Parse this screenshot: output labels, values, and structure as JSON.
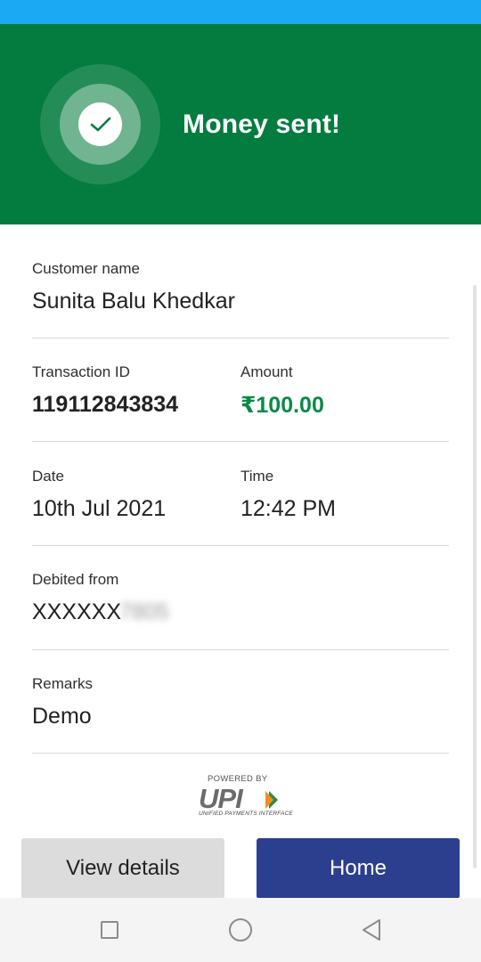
{
  "header": {
    "title": "Money sent!",
    "icon": "check-icon",
    "background_color": "#047c3f"
  },
  "details": {
    "customer_name": {
      "label": "Customer name",
      "value": "Sunita Balu Khedkar"
    },
    "transaction_id": {
      "label": "Transaction ID",
      "value": "119112843834"
    },
    "amount": {
      "label": "Amount",
      "value": "₹100.00",
      "color": "#0a8a47"
    },
    "date": {
      "label": "Date",
      "value": "10th Jul 2021"
    },
    "time": {
      "label": "Time",
      "value": "12:42 PM"
    },
    "debited_from": {
      "label": "Debited from",
      "value_visible": "XXXXXX",
      "value_blurred": "7805"
    },
    "remarks": {
      "label": "Remarks",
      "value": "Demo"
    }
  },
  "branding": {
    "powered_by": "POWERED BY",
    "logo_text": "UPI",
    "logo_subtitle": "UNIFIED PAYMENTS INTERFACE"
  },
  "actions": {
    "view_details_label": "View details",
    "home_label": "Home",
    "home_color": "#2c3f8f"
  },
  "navigation": {
    "icons": [
      "recent-apps-icon",
      "home-circle-icon",
      "back-triangle-icon"
    ]
  }
}
